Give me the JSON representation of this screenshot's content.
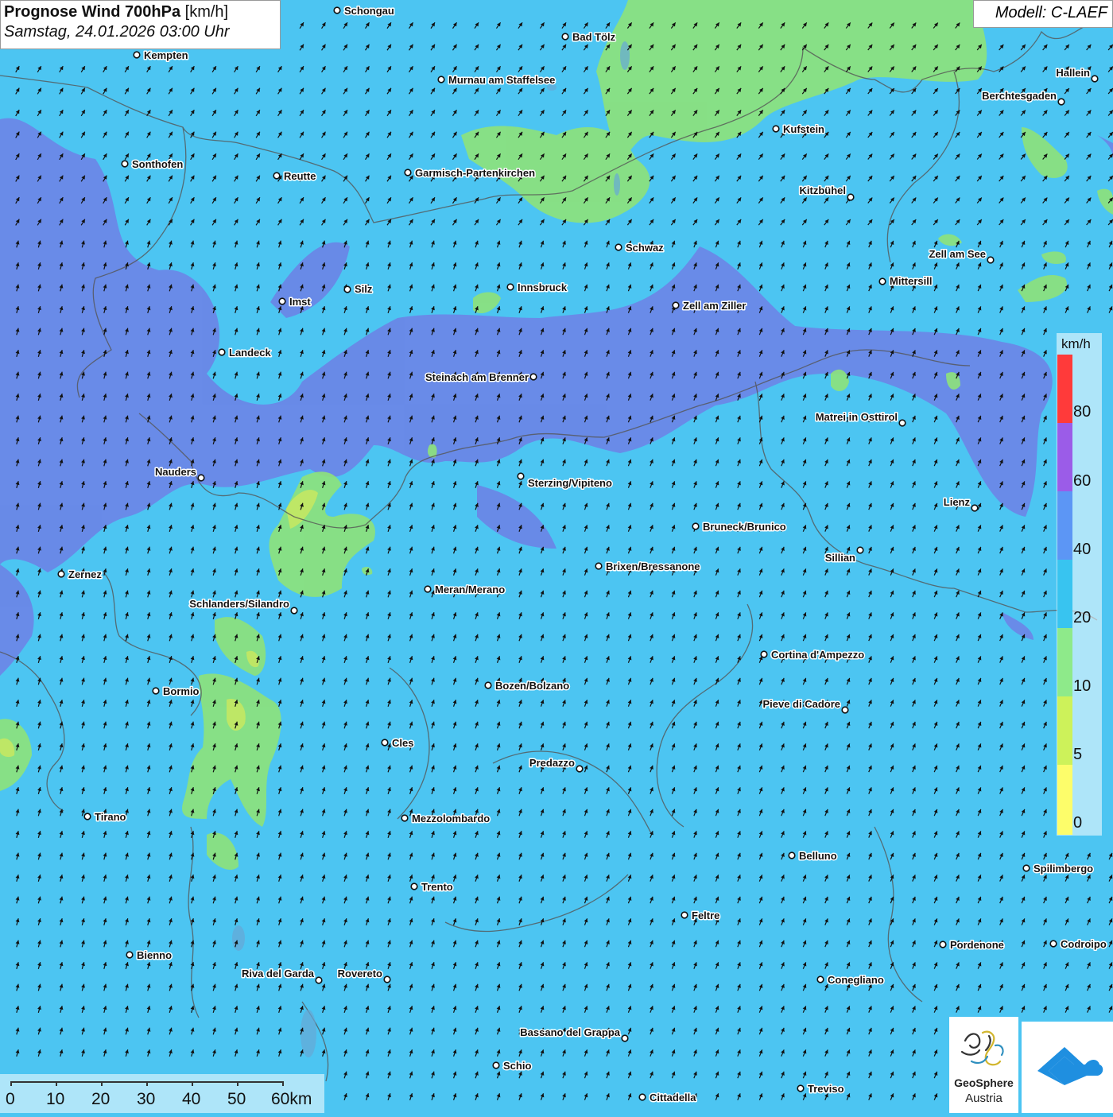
{
  "title": {
    "main": "Prognose Wind 700hPa",
    "unit": "[km/h]",
    "datetime": "Samstag, 24.01.2026 03:00 Uhr"
  },
  "model": "Modell: C-LAEF",
  "legend": {
    "unit": "km/h",
    "ticks": [
      "80",
      "60",
      "40",
      "20",
      "10",
      "5",
      "0"
    ],
    "colors": {
      "above_80": "#ff3a3a",
      "60_80": "#9b5ce8",
      "40_60": "#5c96f5",
      "20_40": "#38c4f0",
      "10_20": "#8eea8a",
      "5_10": "#cdf25a",
      "0_5": "#fdfd6a"
    }
  },
  "map_colors": {
    "wind_20_40": "#4cc5f2",
    "wind_40_60": "#6e80e6",
    "wind_10_20": "#8ee27a",
    "wind_5_10": "#c8e860",
    "borders": "#555555",
    "arrows": "#111111"
  },
  "wind_direction": "north to north-north-east",
  "scale_bar": {
    "labels": [
      "0",
      "10",
      "20",
      "30",
      "40",
      "50",
      "60km"
    ]
  },
  "cities": [
    "Schongau",
    "Kempten",
    "Bad Tölz",
    "Murnau am Staffelsee",
    "Hallein",
    "Berchtesgaden",
    "Kufstein",
    "Sonthofen",
    "Reutte",
    "Garmisch-Partenkirchen",
    "Kitzbühel",
    "Schwaz",
    "Zell am See",
    "Mittersill",
    "Imst",
    "Silz",
    "Innsbruck",
    "Zell am Ziller",
    "Landeck",
    "Steinach am Brenner",
    "Matrei in Osttirol",
    "Nauders",
    "Sterzing/Vipiteno",
    "Lienz",
    "Bruneck/Brunico",
    "Sillian",
    "Zernez",
    "Brixen/Bressanone",
    "Meran/Merano",
    "Schlanders/Silandro",
    "Cortina d'Ampezzo",
    "Bozen/Bolzano",
    "Bormio",
    "Pieve di Cadore",
    "Cles",
    "Predazzo",
    "Tirano",
    "Mezzolombardo",
    "Belluno",
    "Spilimbergo",
    "Trento",
    "Feltre",
    "Pordenone",
    "Codroipo",
    "Bienno",
    "Riva del Garda",
    "Rovereto",
    "Conegliano",
    "Bassano del Grappa",
    "Schio",
    "Treviso",
    "Cittadella"
  ],
  "logos": {
    "geosphere_name": "GeoSphere",
    "geosphere_sub": "Austria"
  }
}
